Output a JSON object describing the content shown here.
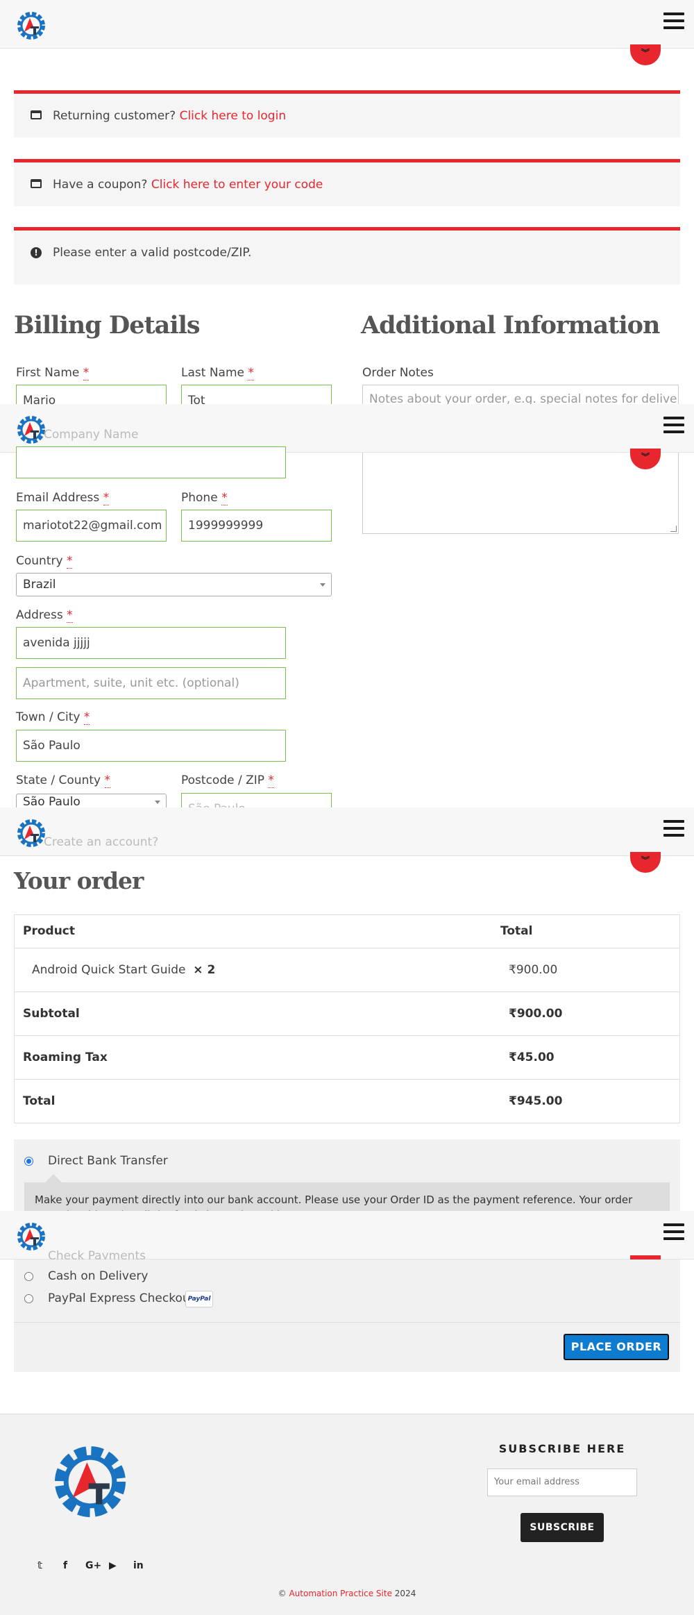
{
  "header": {
    "logo_alt": "Automation Practice Site",
    "menu_icon": "hamburger-icon"
  },
  "notices": {
    "returning_prefix": "Returning customer?",
    "returning_link": "Click here to login",
    "coupon_prefix": "Have a coupon?",
    "coupon_link": "Click here to enter your code",
    "error": "Please enter a valid postcode/ZIP."
  },
  "billing": {
    "title": "Billing Details",
    "first_name_label": "First Name",
    "first_name_value": "Mario",
    "last_name_label": "Last Name",
    "last_name_value": "Tot",
    "company_label": "Company Name",
    "company_value": "",
    "email_label": "Email Address",
    "email_value": "mariotot22@gmail.com",
    "phone_label": "Phone",
    "phone_value": "1999999999",
    "country_label": "Country",
    "country_value": "Brazil",
    "address_label": "Address",
    "address_value": "avenida jjjjj",
    "address2_placeholder": "Apartment, suite, unit etc. (optional)",
    "city_label": "Town / City",
    "city_value": "São Paulo",
    "state_label": "State / County",
    "state_value": "São Paulo",
    "postcode_label": "Postcode / ZIP",
    "postcode_value": "São Paulo",
    "required_mark": "*",
    "create_account_label": "Create an account?"
  },
  "additional": {
    "title": "Additional Information",
    "notes_label": "Order Notes",
    "notes_placeholder": "Notes about your order, e.g. special notes for delivery."
  },
  "order": {
    "title": "Your order",
    "col_product": "Product",
    "col_total": "Total",
    "item_name": "Android Quick Start Guide",
    "item_qty": "× 2",
    "item_total": "₹900.00",
    "subtotal_label": "Subtotal",
    "subtotal_value": "₹900.00",
    "tax_label": "Roaming Tax",
    "tax_value": "₹45.00",
    "total_label": "Total",
    "total_value": "₹945.00"
  },
  "payment": {
    "bank_label": "Direct Bank Transfer",
    "bank_desc": "Make your payment directly into our bank account. Please use your Order ID as the payment reference. Your order won't be shipped until the funds have cleared in our account.",
    "check_label": "Check Payments",
    "cod_label": "Cash on Delivery",
    "paypal_label": "PayPal Express Checkout",
    "paypal_badge": "PayPal",
    "place_order": "PLACE ORDER"
  },
  "footer": {
    "subscribe_title": "SUBSCRIBE HERE",
    "email_placeholder": "Your email address",
    "subscribe_button": "SUBSCRIBE",
    "social": {
      "twitter": "twitter-icon",
      "facebook": "facebook-icon",
      "google": "google-plus-icon",
      "youtube": "youtube-icon",
      "linkedin": "linkedin-icon"
    },
    "copyright_symbol": "©",
    "copyright_link": "Automation Practice Site",
    "copyright_year": "2024"
  },
  "colors": {
    "accent": "#e8262d",
    "button_blue": "#0c7bd0",
    "valid_border": "#78c04c",
    "logo_blue": "#1a73c0"
  }
}
